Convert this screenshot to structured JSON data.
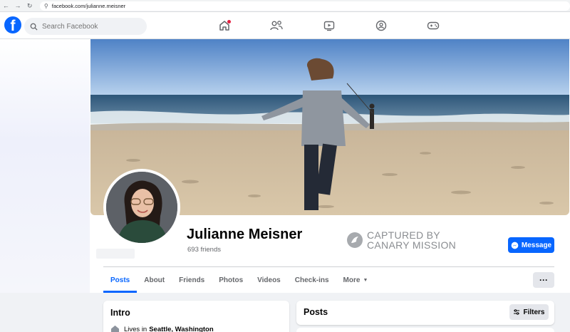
{
  "browser": {
    "url": "facebook.com/julianne.meisner"
  },
  "header": {
    "logo_letter": "f",
    "search_placeholder": "Search Facebook",
    "nav_icons": [
      "home-icon",
      "friends-icon",
      "watch-icon",
      "groups-icon",
      "gaming-icon"
    ],
    "accent_color": "#0866ff",
    "notification_color": "#e41e3f"
  },
  "profile": {
    "name": "Julianne Meisner",
    "friends": "693 friends",
    "message_label": "Message"
  },
  "watermark": {
    "line1": "CAPTURED BY",
    "line2": "CANARY MISSION"
  },
  "tabs": [
    {
      "label": "Posts",
      "active": true
    },
    {
      "label": "About"
    },
    {
      "label": "Friends"
    },
    {
      "label": "Photos"
    },
    {
      "label": "Videos"
    },
    {
      "label": "Check-ins"
    },
    {
      "label": "More"
    }
  ],
  "more_button": "···",
  "intro": {
    "title": "Intro",
    "lives_prefix": "Lives in",
    "lives_city": "Seattle, Washington"
  },
  "posts": {
    "title": "Posts",
    "filters_label": "Filters"
  }
}
